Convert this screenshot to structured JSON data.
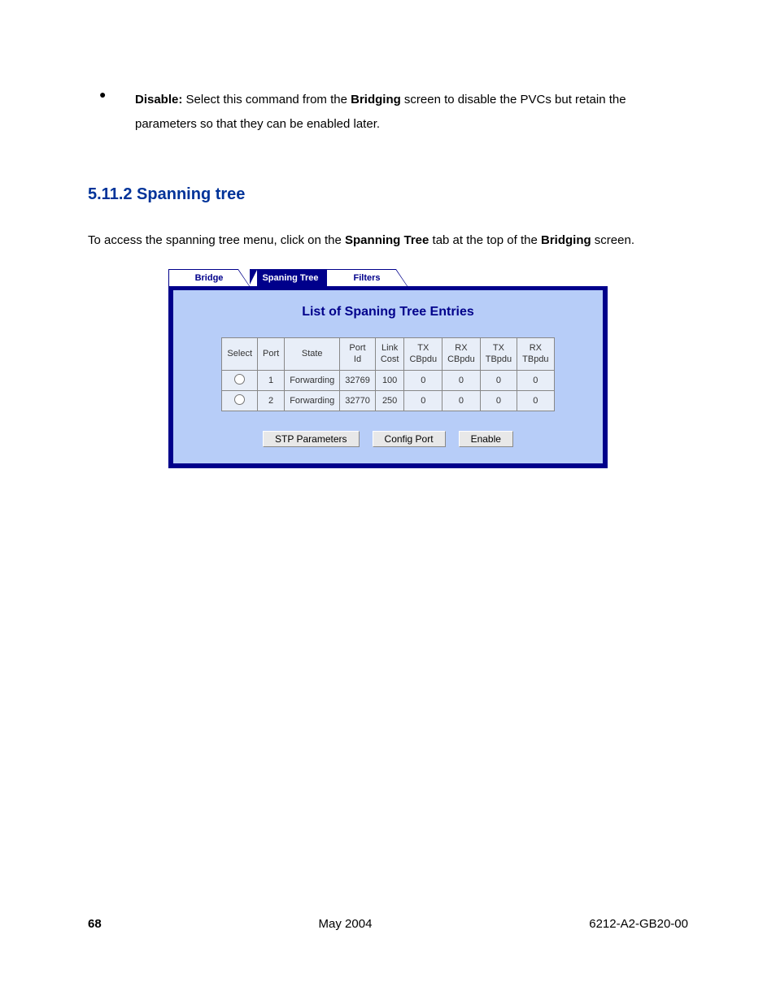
{
  "bullet": {
    "label": "Disable:",
    "text_before": " Select this command from the ",
    "bold1": "Bridging",
    "text_after": " screen to disable the PVCs but retain the parameters so that they can be enabled later."
  },
  "heading": "5.11.2 Spanning tree",
  "para": {
    "before": "To access the spanning tree menu, click on the ",
    "bold1": "Spanning Tree",
    "mid": " tab at the top of the ",
    "bold2": "Bridging",
    "after": " screen."
  },
  "ui": {
    "tabs": [
      "Bridge",
      "Spaning Tree",
      "Filters"
    ],
    "panel_title": "List of Spaning Tree Entries",
    "headers": [
      "Select",
      "Port",
      "State",
      "Port Id",
      "Link Cost",
      "TX CBpdu",
      "RX CBpdu",
      "TX TBpdu",
      "RX TBpdu"
    ],
    "rows": [
      {
        "port": "1",
        "state": "Forwarding",
        "port_id": "32769",
        "link_cost": "100",
        "tx_cbpdu": "0",
        "rx_cbpdu": "0",
        "tx_tbpdu": "0",
        "rx_tbpdu": "0"
      },
      {
        "port": "2",
        "state": "Forwarding",
        "port_id": "32770",
        "link_cost": "250",
        "tx_cbpdu": "0",
        "rx_cbpdu": "0",
        "tx_tbpdu": "0",
        "rx_tbpdu": "0"
      }
    ],
    "buttons": [
      "STP Parameters",
      "Config Port",
      "Enable"
    ]
  },
  "footer": {
    "page": "68",
    "date": "May 2004",
    "docid": "6212-A2-GB20-00"
  }
}
